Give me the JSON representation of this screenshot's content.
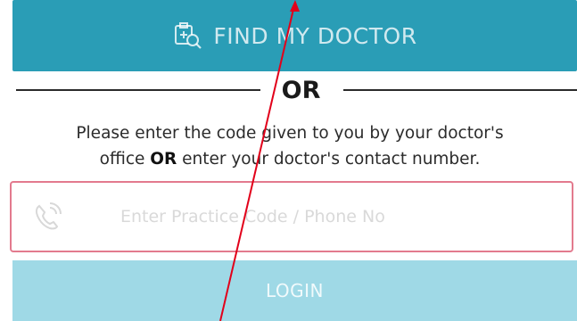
{
  "find_doctor": {
    "label": "FIND MY DOCTOR",
    "icon": "doctor-search-icon"
  },
  "divider": {
    "label": "OR"
  },
  "instructions": {
    "line1": "Please enter the code given to you by your doctor's",
    "line2_prefix": "office ",
    "line2_bold": "OR",
    "line2_suffix": " enter your doctor's contact number."
  },
  "code_input": {
    "placeholder": "Enter Practice Code / Phone No",
    "value": "",
    "icon": "phone-icon"
  },
  "login": {
    "label": "LOGIN"
  },
  "colors": {
    "primary": "#2a9db6",
    "primary_disabled": "#9fd9e6",
    "input_border": "#e37a8e",
    "annotation": "#e2001a"
  }
}
